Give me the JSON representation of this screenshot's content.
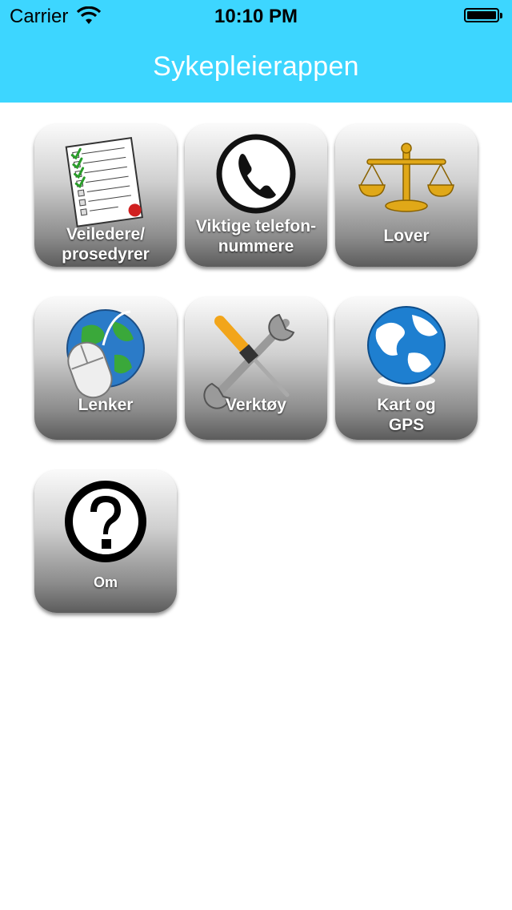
{
  "status_bar": {
    "carrier": "Carrier",
    "time": "10:10 PM",
    "battery_level": 1.0
  },
  "nav": {
    "title": "Sykepleierappen"
  },
  "tiles": [
    {
      "label_line1": "Veiledere/",
      "label_line2": "prosedyrer",
      "icon": "checklist-icon"
    },
    {
      "label_line1": "Viktige telefon-",
      "label_line2": "nummere",
      "icon": "phone-icon"
    },
    {
      "label_line1": "Lover",
      "label_line2": "",
      "icon": "scales-icon"
    },
    {
      "label_line1": "Lenker",
      "label_line2": "",
      "icon": "globe-mouse-icon"
    },
    {
      "label_line1": "Verktøy",
      "label_line2": "",
      "icon": "tools-icon"
    },
    {
      "label_line1": "Kart og",
      "label_line2": "GPS",
      "icon": "globe-icon"
    },
    {
      "label_line1": "Om",
      "label_line2": "",
      "icon": "question-icon"
    }
  ],
  "colors": {
    "nav_background": "#3dd6ff",
    "tile_text": "#ffffff"
  }
}
